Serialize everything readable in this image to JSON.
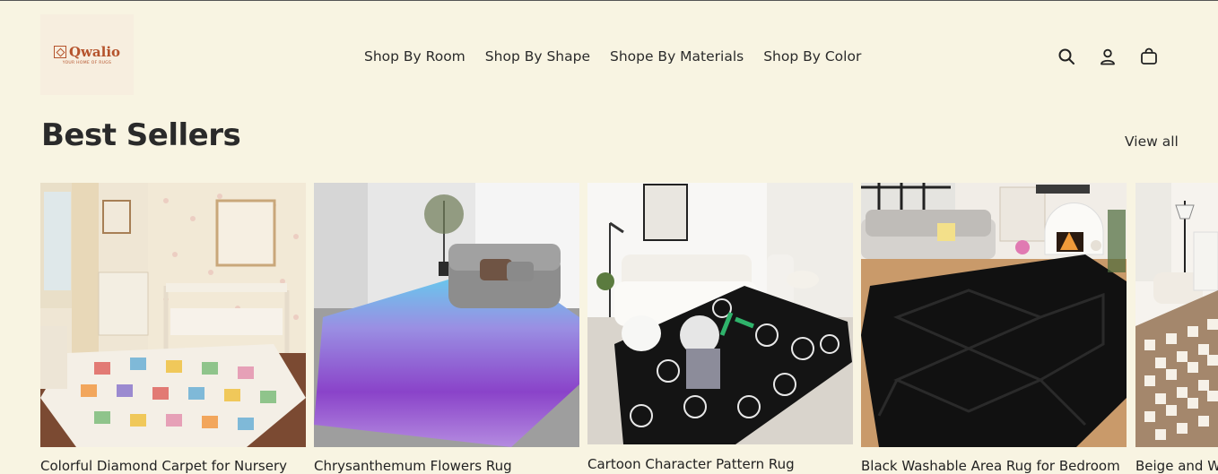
{
  "brand": {
    "name": "Qwalio",
    "tagline": "YOUR HOME OF RUGS"
  },
  "nav": [
    "Shop By Room",
    "Shop By Shape",
    "Shope By Materials",
    "Shop By Color"
  ],
  "icons": [
    "search-icon",
    "account-icon",
    "cart-icon"
  ],
  "section": {
    "title": "Best Sellers",
    "view_all": "View all"
  },
  "products": [
    {
      "title": "Colorful Diamond Carpet for Nursery"
    },
    {
      "title": "Chrysanthemum Flowers Rug"
    },
    {
      "title": "Cartoon Character Pattern Rug"
    },
    {
      "title": "Black Washable Area Rug for Bedroom"
    },
    {
      "title": "Beige and Wh"
    }
  ]
}
